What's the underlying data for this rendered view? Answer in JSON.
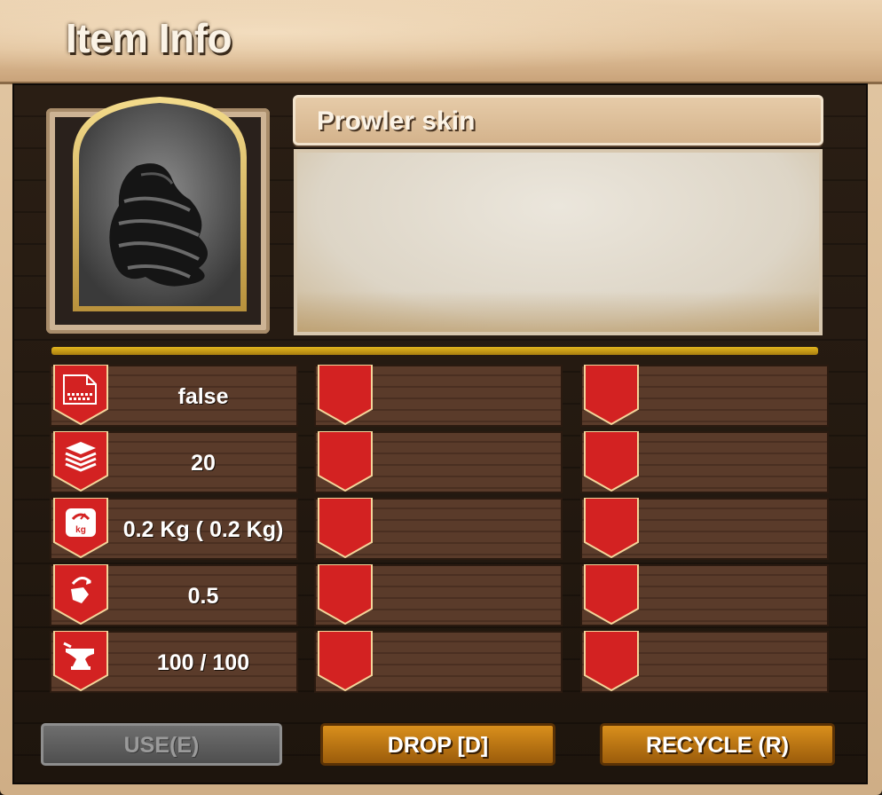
{
  "window": {
    "title": "Item Info"
  },
  "item": {
    "name": "Prowler skin",
    "icon": "dark-creature-skin-icon",
    "description": ""
  },
  "stats": [
    {
      "icon": "blueprint-icon",
      "value": "false"
    },
    {
      "icon": "stack-icon",
      "value": "20"
    },
    {
      "icon": "weight-scale-icon",
      "value": "0.2 Kg ( 0.2 Kg)"
    },
    {
      "icon": "decay-icon",
      "value": "0.5"
    },
    {
      "icon": "anvil-icon",
      "value": "100 / 100"
    }
  ],
  "buttons": {
    "use": "USE(E)",
    "drop": "DROP [D]",
    "recycle": "RECYCLE (R)"
  },
  "colors": {
    "ribbon_red": "#d32222",
    "gold_rule": "#d4a61a",
    "button_orange": "#c67a14",
    "button_disabled": "#666666"
  }
}
